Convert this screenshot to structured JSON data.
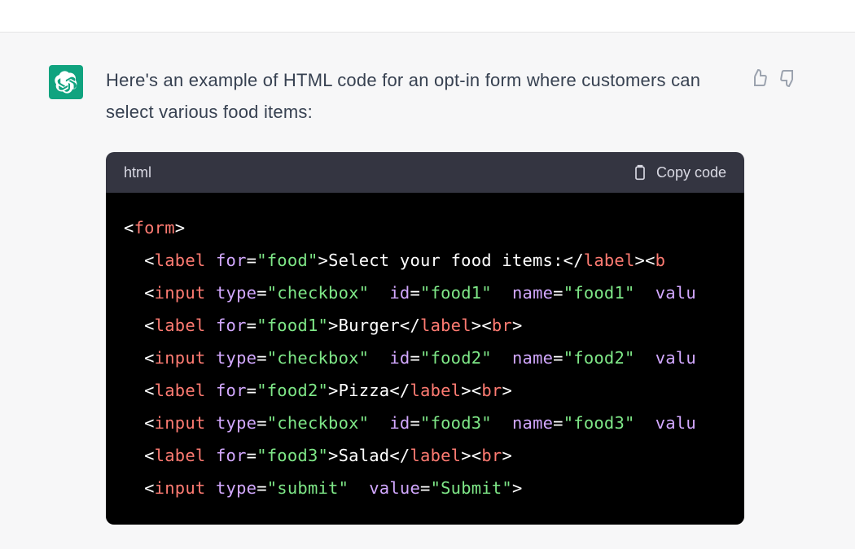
{
  "message": {
    "intro": "Here's an example of HTML code for an opt-in form where customers can select various food items:"
  },
  "codeBlock": {
    "language": "html",
    "copyLabel": "Copy code"
  },
  "code": {
    "l1": {
      "p1": "<",
      "t": "form",
      "p2": ">"
    },
    "l2": {
      "pad": "  ",
      "p1": "<",
      "t": "label",
      "sp": " ",
      "a": "for",
      "eq": "=",
      "s": "\"food\"",
      "p2": ">",
      "tx": "Select your food items:",
      "p3": "</",
      "t2": "label",
      "p4": "><",
      "t3": "b"
    },
    "l3": {
      "pad": "  ",
      "p1": "<",
      "t": "input",
      "sp": " ",
      "a1": "type",
      "eq1": "=",
      "s1": "\"checkbox\"",
      "sp2": "  ",
      "a2": "id",
      "eq2": "=",
      "s2": "\"food1\"",
      "sp3": "  ",
      "a3": "name",
      "eq3": "=",
      "s3": "\"food1\"",
      "sp4": "  ",
      "a4": "valu"
    },
    "l4": {
      "pad": "  ",
      "p1": "<",
      "t": "label",
      "sp": " ",
      "a": "for",
      "eq": "=",
      "s": "\"food1\"",
      "p2": ">",
      "tx": "Burger",
      "p3": "</",
      "t2": "label",
      "p4": "><",
      "t3": "br",
      "p5": ">"
    },
    "l5": {
      "pad": "  ",
      "p1": "<",
      "t": "input",
      "sp": " ",
      "a1": "type",
      "eq1": "=",
      "s1": "\"checkbox\"",
      "sp2": "  ",
      "a2": "id",
      "eq2": "=",
      "s2": "\"food2\"",
      "sp3": "  ",
      "a3": "name",
      "eq3": "=",
      "s3": "\"food2\"",
      "sp4": "  ",
      "a4": "valu"
    },
    "l6": {
      "pad": "  ",
      "p1": "<",
      "t": "label",
      "sp": " ",
      "a": "for",
      "eq": "=",
      "s": "\"food2\"",
      "p2": ">",
      "tx": "Pizza",
      "p3": "</",
      "t2": "label",
      "p4": "><",
      "t3": "br",
      "p5": ">"
    },
    "l7": {
      "pad": "  ",
      "p1": "<",
      "t": "input",
      "sp": " ",
      "a1": "type",
      "eq1": "=",
      "s1": "\"checkbox\"",
      "sp2": "  ",
      "a2": "id",
      "eq2": "=",
      "s2": "\"food3\"",
      "sp3": "  ",
      "a3": "name",
      "eq3": "=",
      "s3": "\"food3\"",
      "sp4": "  ",
      "a4": "valu"
    },
    "l8": {
      "pad": "  ",
      "p1": "<",
      "t": "label",
      "sp": " ",
      "a": "for",
      "eq": "=",
      "s": "\"food3\"",
      "p2": ">",
      "tx": "Salad",
      "p3": "</",
      "t2": "label",
      "p4": "><",
      "t3": "br",
      "p5": ">"
    },
    "l9": {
      "pad": "  ",
      "p1": "<",
      "t": "input",
      "sp": " ",
      "a1": "type",
      "eq1": "=",
      "s1": "\"submit\"",
      "sp2": "  ",
      "a2": "value",
      "eq2": "=",
      "s2": "\"Submit\"",
      "p2": ">"
    }
  }
}
